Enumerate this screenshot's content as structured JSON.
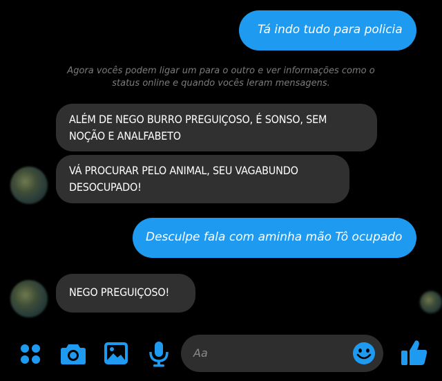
{
  "messages": [
    {
      "direction": "outgoing",
      "text": "Tá indo tudo para policia"
    },
    {
      "direction": "incoming",
      "text": "ALÉM DE NEGO BURRO PREGUIÇOSO, É SONSO, SEM NOÇÃO E ANALFABETO"
    },
    {
      "direction": "incoming",
      "text": "VÁ PROCURAR PELO ANIMAL, SEU VAGABUNDO DESOCUPADO!"
    },
    {
      "direction": "outgoing",
      "text": "Desculpe fala com aminha mão Tô ocupado"
    },
    {
      "direction": "incoming",
      "text": "NEGO PREGUIÇOSO!"
    }
  ],
  "notice": {
    "line1": "Agora vocês podem ligar um para o outro e ver informações como o",
    "line2": "status online e quando vocês leram mensagens."
  },
  "composer": {
    "placeholder": "Aa",
    "icons": [
      "apps-icon",
      "camera-icon",
      "gallery-icon",
      "microphone-icon",
      "emoji-icon",
      "thumbs-up-icon"
    ]
  },
  "colors": {
    "accent": "#1e9bf0",
    "incoming_bubble": "#303030",
    "background": "#000000"
  }
}
